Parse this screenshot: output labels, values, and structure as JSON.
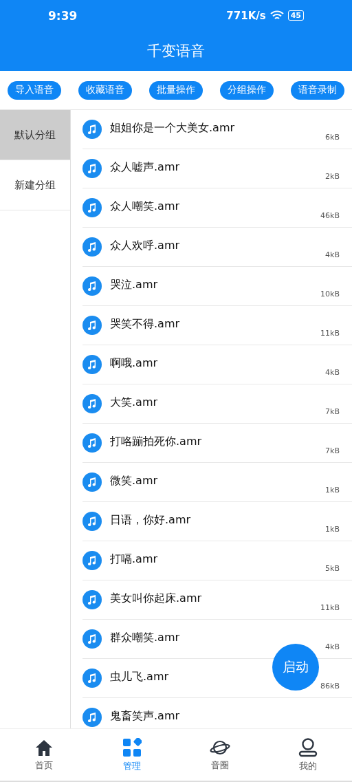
{
  "status_bar": {
    "time": "9:39",
    "speed": "771K/s",
    "battery": "45"
  },
  "header": {
    "title": "千变语音"
  },
  "actions": [
    "导入语音",
    "收藏语音",
    "批量操作",
    "分组操作",
    "语音录制"
  ],
  "groups": [
    {
      "label": "默认分组",
      "selected": true
    },
    {
      "label": "新建分组",
      "selected": false
    }
  ],
  "files": [
    {
      "name": "姐姐你是一个大美女.amr",
      "size": "6kB"
    },
    {
      "name": "众人嘘声.amr",
      "size": "2kB"
    },
    {
      "name": "众人嘲笑.amr",
      "size": "46kB"
    },
    {
      "name": "众人欢呼.amr",
      "size": "4kB"
    },
    {
      "name": "哭泣.amr",
      "size": "10kB"
    },
    {
      "name": "哭笑不得.amr",
      "size": "11kB"
    },
    {
      "name": "啊哦.amr",
      "size": "4kB"
    },
    {
      "name": "大笑.amr",
      "size": "7kB"
    },
    {
      "name": "打咯蹦拍死你.amr",
      "size": "7kB"
    },
    {
      "name": "微笑.amr",
      "size": "1kB"
    },
    {
      "name": "日语，你好.amr",
      "size": "1kB"
    },
    {
      "name": "打嗝.amr",
      "size": "5kB"
    },
    {
      "name": "美女叫你起床.amr",
      "size": "11kB"
    },
    {
      "name": "群众嘲笑.amr",
      "size": "4kB"
    },
    {
      "name": "虫儿飞.amr",
      "size": "86kB"
    },
    {
      "name": "鬼畜笑声.amr"
    }
  ],
  "fab": "启动",
  "nav": [
    {
      "label": "首页",
      "kind": "home",
      "selected": false
    },
    {
      "label": "管理",
      "kind": "manage",
      "selected": true
    },
    {
      "label": "音圈",
      "kind": "planet",
      "selected": false
    },
    {
      "label": "我的",
      "kind": "user",
      "selected": false
    }
  ]
}
